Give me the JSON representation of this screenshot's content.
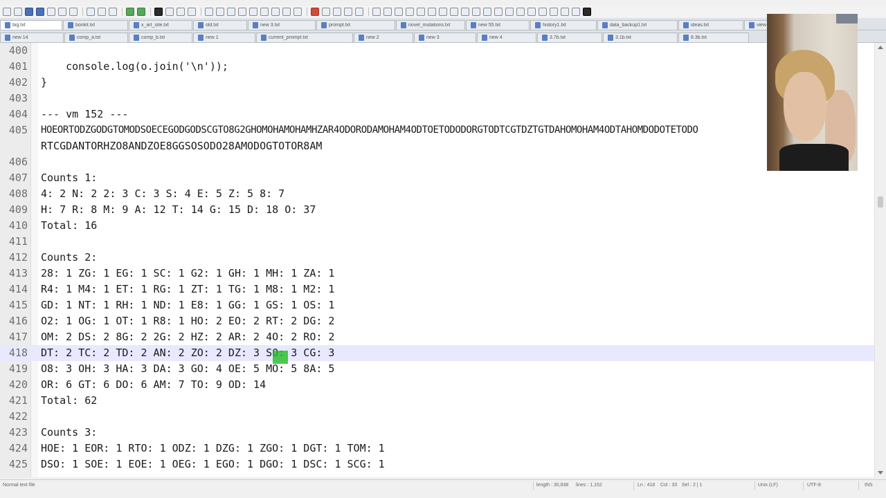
{
  "tabs_row1": [
    "big.txt",
    "bonkit.txt",
    "x_art_site.txt",
    "old.txt",
    "new 3.txt",
    "prompt.txt",
    "novel_mutations.txt",
    "new 55.txt",
    "history1.txt",
    "data_backup1.txt",
    "ideas.txt",
    "view"
  ],
  "tabs_row2": [
    "new 14",
    "comp_a.txt",
    "comp_b.txt",
    "new 1",
    "current_prompt.txt",
    "new 2",
    "new 3",
    "new 4",
    "3.7b.txt",
    "3.1b.txt",
    "8.3b.txt"
  ],
  "lines": [
    {
      "n": "400",
      "text": ""
    },
    {
      "n": "401",
      "text": "    console.log(o.join('\\n'));"
    },
    {
      "n": "402",
      "text": "}"
    },
    {
      "n": "403",
      "text": ""
    },
    {
      "n": "404",
      "text": "--- vm 152 ---"
    },
    {
      "n": "405",
      "text": "HOEORTODZGODGTOMODSOECEGODGODSCGTO8G2GHOMOHAMOHAMHZAR4ODORODAMOHAM4ODTOETODODORGTODTCGTDZTGTDAHOMOHAM4ODTAHOMDODOTETODO"
    },
    {
      "n": "",
      "text": "RTCGDANTORHZO8ANDZOE8GGSOSODO28AMODOGTOTOR8AM"
    },
    {
      "n": "406",
      "text": ""
    },
    {
      "n": "407",
      "text": "Counts 1:"
    },
    {
      "n": "408",
      "text": "4: 2 N: 2 2: 3 C: 3 S: 4 E: 5 Z: 5 8: 7"
    },
    {
      "n": "409",
      "text": "H: 7 R: 8 M: 9 A: 12 T: 14 G: 15 D: 18 O: 37"
    },
    {
      "n": "410",
      "text": "Total: 16"
    },
    {
      "n": "411",
      "text": ""
    },
    {
      "n": "412",
      "text": "Counts 2:"
    },
    {
      "n": "413",
      "text": "28: 1 ZG: 1 EG: 1 SC: 1 G2: 1 GH: 1 MH: 1 ZA: 1"
    },
    {
      "n": "414",
      "text": "R4: 1 M4: 1 ET: 1 RG: 1 ZT: 1 TG: 1 M8: 1 M2: 1"
    },
    {
      "n": "415",
      "text": "GD: 1 NT: 1 RH: 1 ND: 1 E8: 1 GG: 1 GS: 1 OS: 1"
    },
    {
      "n": "416",
      "text": "O2: 1 OG: 1 OT: 1 R8: 1 HO: 2 EO: 2 RT: 2 DG: 2"
    },
    {
      "n": "417",
      "text": "OM: 2 DS: 2 8G: 2 2G: 2 HZ: 2 AR: 2 4O: 2 RO: 2"
    },
    {
      "n": "418",
      "text": "DT: 2 TC: 2 TD: 2 AN: 2 ZO: 2 DZ: 3 SO: 3 CG: 3"
    },
    {
      "n": "419",
      "text": "O8: 3 OH: 3 HA: 3 DA: 3 GO: 4 OE: 5 MO: 5 8A: 5"
    },
    {
      "n": "420",
      "text": "OR: 6 GT: 6 DO: 6 AM: 7 TO: 9 OD: 14"
    },
    {
      "n": "421",
      "text": "Total: 62"
    },
    {
      "n": "422",
      "text": ""
    },
    {
      "n": "423",
      "text": "Counts 3:"
    },
    {
      "n": "424",
      "text": "HOE: 1 EOR: 1 RTO: 1 ODZ: 1 DZG: 1 ZGO: 1 DGT: 1 TOM: 1"
    },
    {
      "n": "425",
      "text": "DSO: 1 SOE: 1 EOE: 1 OEG: 1 EGO: 1 DGO: 1 DSC: 1 SCG: 1"
    }
  ],
  "current_line": "418",
  "status": {
    "file_type": "Normal text file",
    "length": "length : 30,838",
    "lines": "lines : 1,152",
    "position": "Ln : 418",
    "column": "Col : 33",
    "selection": "Sel : 2 | 1",
    "eol": "Unix (LF)",
    "encoding": "UTF-8",
    "mode": "INS"
  },
  "colors": {
    "current_line_bg": "#e8e8ff",
    "match_highlight": "#22bb22",
    "gutter_bg": "#ececec"
  }
}
